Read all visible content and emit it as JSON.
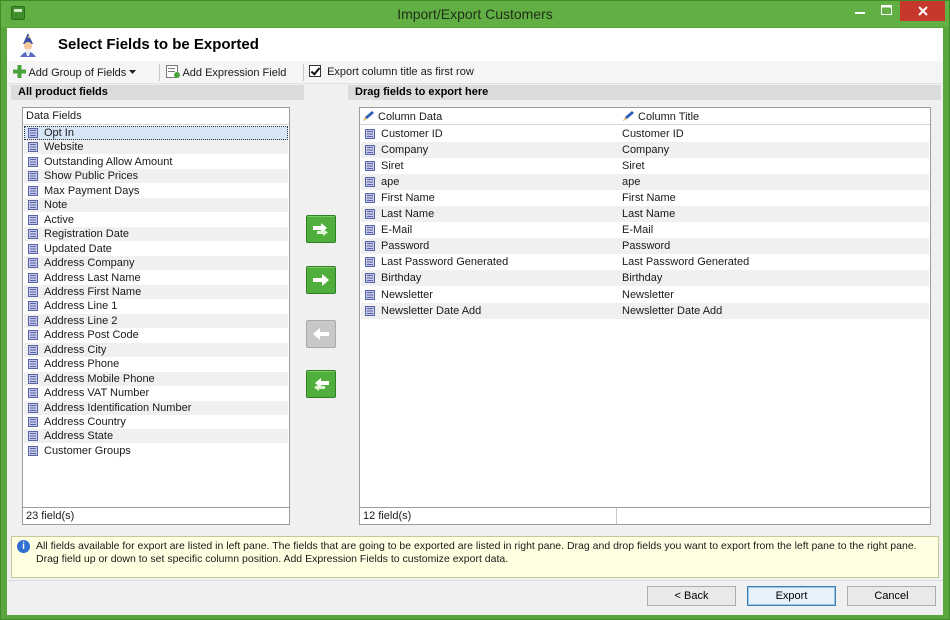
{
  "window": {
    "title": "Import/Export Customers",
    "accent_color": "#5aa63c",
    "close_color": "#c7382c"
  },
  "header": {
    "title": "Select Fields to be Exported"
  },
  "toolbar": {
    "add_group_label": "Add Group of Fields",
    "add_expression_label": "Add Expression Field",
    "export_title_checkbox_label": "Export column title as first row",
    "export_title_checked": true
  },
  "left_pane": {
    "header": "All product fields",
    "column_header": "Data Fields",
    "items": [
      "Opt In",
      "Website",
      "Outstanding Allow Amount",
      "Show Public Prices",
      "Max Payment Days",
      "Note",
      "Active",
      "Registration Date",
      "Updated Date",
      "Address Company",
      "Address Last Name",
      "Address First Name",
      "Address Line 1",
      "Address Line 2",
      "Address Post Code",
      "Address City",
      "Address Phone",
      "Address Mobile Phone",
      "Address VAT Number",
      "Address Identification Number",
      "Address Country",
      "Address State",
      "Customer Groups"
    ],
    "selected_item": "Opt In",
    "footer": "23 field(s)"
  },
  "right_pane": {
    "header": "Drag fields to export here",
    "columns": [
      "Column Data",
      "Column Title"
    ],
    "rows": [
      [
        "Customer ID",
        "Customer ID"
      ],
      [
        "Company",
        "Company"
      ],
      [
        "Siret",
        "Siret"
      ],
      [
        "ape",
        "ape"
      ],
      [
        "First Name",
        "First Name"
      ],
      [
        "Last Name",
        "Last Name"
      ],
      [
        "E-Mail",
        "E-Mail"
      ],
      [
        "Password",
        "Password"
      ],
      [
        "Last Password Generated",
        "Last Password Generated"
      ],
      [
        "Birthday",
        "Birthday"
      ],
      [
        "Newsletter",
        "Newsletter"
      ],
      [
        "Newsletter Date Add",
        "Newsletter Date Add"
      ]
    ],
    "footer": "12 field(s)"
  },
  "move_buttons": [
    {
      "name": "add-all-fields-button",
      "icon": "double-arrow-right-icon",
      "enabled": true
    },
    {
      "name": "add-field-button",
      "icon": "arrow-right-icon",
      "enabled": true
    },
    {
      "name": "remove-field-button",
      "icon": "arrow-left-icon",
      "enabled": false
    },
    {
      "name": "remove-all-fields-button",
      "icon": "double-arrow-left-icon",
      "enabled": true
    }
  ],
  "info": {
    "text": "All fields available for export are listed in left pane. The fields that are going to be exported are listed in right pane. Drag and drop fields you want to export from the left pane to the right pane. Drag field up or down to set specific column position. Add Expression Fields to customize export data."
  },
  "buttons": {
    "back_label": "Back",
    "export_label": "Export",
    "cancel_label": "Cancel"
  }
}
